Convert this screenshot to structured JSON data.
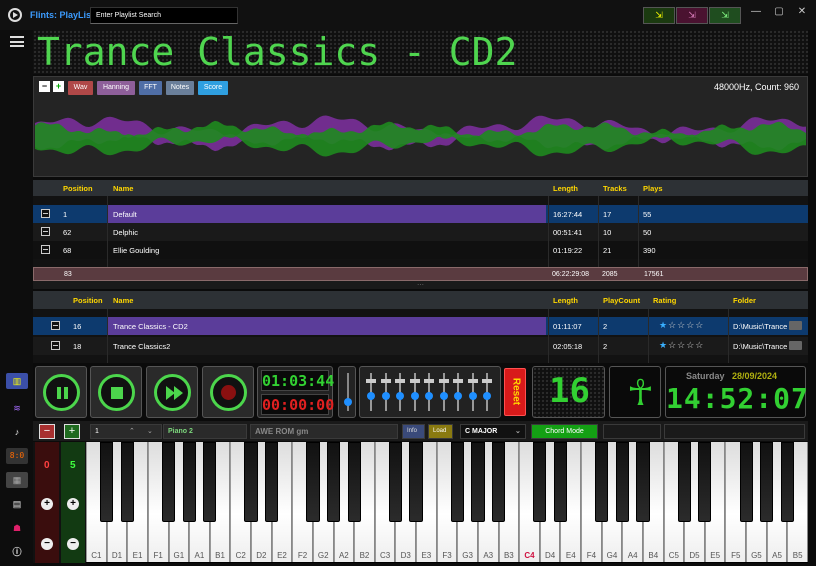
{
  "titlebar": {
    "title": "Flints: PlayList",
    "search_placeholder": "Enter Playlist Search",
    "sys_labels": [
      "—",
      "▢",
      "✕"
    ]
  },
  "display": {
    "title": "Trance Classics - CD2"
  },
  "wave_toolbar": {
    "buttons": [
      "Wav",
      "Hanning",
      "FFT",
      "Notes",
      "Score"
    ],
    "info": "48000Hz, Count: 960"
  },
  "playlists_table": {
    "columns": [
      "Position",
      "Name",
      "Length",
      "Tracks",
      "Plays"
    ],
    "rows": [
      {
        "position": "1",
        "name": "Default",
        "length": "16:27:44",
        "tracks": "17",
        "plays": "55"
      },
      {
        "position": "62",
        "name": "Delphic",
        "length": "00:51:41",
        "tracks": "10",
        "plays": "50"
      },
      {
        "position": "68",
        "name": "Ellie Goulding",
        "length": "01:19:22",
        "tracks": "21",
        "plays": "390"
      }
    ],
    "totals": {
      "position": "83",
      "length": "06:22:29:08",
      "tracks": "2085",
      "plays": "17561"
    }
  },
  "tracks_table": {
    "columns": [
      "Position",
      "Name",
      "Length",
      "PlayCount",
      "Rating",
      "Folder"
    ],
    "rows": [
      {
        "position": "16",
        "name": "Trance Classics - CD2",
        "length": "01:11:07",
        "playcount": "2",
        "rating": 1,
        "folder": "D:\\Music\\Trance"
      },
      {
        "position": "18",
        "name": "Trance Classics2",
        "length": "02:05:18",
        "playcount": "2",
        "rating": 1,
        "folder": "D:\\Music\\Trance"
      }
    ]
  },
  "clock_panel": {
    "elapsed": "01:03:44",
    "remaining": "00:00:00"
  },
  "reset_label": "Reset",
  "track_number": "16",
  "datetime": {
    "day": "Saturday",
    "date": "28/09/2024",
    "time": "14:52:07"
  },
  "keyboard_bar": {
    "channel": "1",
    "instrument": "Piano 2",
    "soundfont": "AWE ROM gm",
    "info_label": "Info",
    "load_label": "Load",
    "key": "C MAJOR",
    "chord_mode": "Chord Mode"
  },
  "left_controls": {
    "octave_down": "0",
    "octave_up": "5"
  },
  "piano": {
    "keys": [
      "C1",
      "D1",
      "E1",
      "F1",
      "G1",
      "A1",
      "B1",
      "C2",
      "D2",
      "E2",
      "F2",
      "G2",
      "A2",
      "B2",
      "C3",
      "D3",
      "E3",
      "F3",
      "G3",
      "A3",
      "B3",
      "C4",
      "D4",
      "E4",
      "F4",
      "G4",
      "A4",
      "B4",
      "C5",
      "D5",
      "E5",
      "F5",
      "G5",
      "A5",
      "B5"
    ],
    "highlight": "C4"
  },
  "colors": {
    "accent": "#4cd64c",
    "selected_row": "#0d3a6e",
    "highlight_row": "#5b3d9a",
    "title_blue": "#3c9cff",
    "header_gold": "#ffd700",
    "reset": "#d81a1a"
  },
  "sidebar_icons": [
    "menu-icon",
    "equalizer-icon",
    "waveform-icon",
    "guitar-icon",
    "clock-icon",
    "grid-icon",
    "piano-icon",
    "invader-icon",
    "info-icon"
  ]
}
